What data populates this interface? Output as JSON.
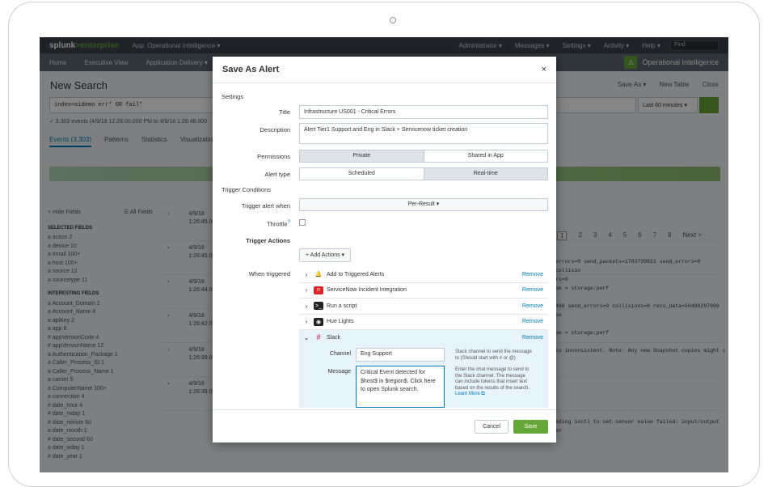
{
  "topbar": {
    "logo_a": "splunk",
    "logo_b": ">enterprise",
    "app": "App: Operational Intelligence ▾",
    "admin": "Administrator ▾",
    "messages": "Messages ▾",
    "settings": "Settings ▾",
    "activity": "Activity ▾",
    "help": "Help ▾",
    "find": "Find"
  },
  "appbar": {
    "items": [
      "Home",
      "Executive View",
      "Application Delivery ▾"
    ],
    "app_title": "Operational Intelligence"
  },
  "background": {
    "title": "New Search",
    "actions": [
      "Save As ▾",
      "New Table",
      "Close"
    ],
    "query": "index=oidemo err* OR fail*",
    "time_range": "Last 60 minutes ▾",
    "status": "✓ 3,303 events (4/9/18 12:26:00.000 PM to 4/9/18 1:26:48.000",
    "tabs": [
      "Events (3,303)",
      "Patterns",
      "Statistics",
      "Visualization"
    ],
    "pager": [
      "1",
      "2",
      "3",
      "4",
      "5",
      "6",
      "7",
      "8",
      "Next >"
    ],
    "sidebar": {
      "hide": "< Hide Fields",
      "all": "☰ All Fields",
      "selected_header": "SELECTED FIELDS",
      "selected": [
        "a action 2",
        "a device 10",
        "a email 100+",
        "a host 100+",
        "a source 12",
        "a sourcetype 11"
      ],
      "interesting_header": "INTERESTING FIELDS",
      "interesting": [
        "a Account_Domain 2",
        "a Account_Name 4",
        "a apiKey 2",
        "a app 6",
        "# appVersionCode 4",
        "# appVersionName 12",
        "a Authentication_Package 1",
        "a Caller_Process_ID 1",
        "a Caller_Process_Name 1",
        "a carrier 5",
        "a ComputerName 100+",
        "a connection 4",
        "# date_hour 4",
        "# date_mday 1",
        "# date_minute 60",
        "a date_month 1",
        "# date_second 60",
        "a date_wday 1",
        "# date_year 1"
      ]
    },
    "rows": [
      {
        "date": "4/9/18",
        "time": "1:26:45.000"
      },
      {
        "date": "4/9/18",
        "time": "1:26:45.000"
      },
      {
        "date": "4/9/18",
        "time": "1:26:44.000"
      },
      {
        "date": "4/9/18",
        "time": "1:26:42.000"
      },
      {
        "date": "4/9/18",
        "time": "1:26:39.000"
      },
      {
        "date": "4/9/18",
        "time": "1:26:39.000"
      }
    ],
    "code_lines": [
      "errors=0 send_packets=1783739821 send_errors=0 collisio",
      "rs=0",
      "pe = storage:perf",
      "",
      "468 send_errors=0 collisions=0 recv_data=50496297609 se",
      "",
      "pe = storage:perf",
      "",
      "is inconsistent. Note: Any new Snapshot copies might c",
      "",
      "",
      "",
      "",
      "",
      "",
      "",
      "ading ioctl to set sensor value failed: input/output er"
    ]
  },
  "modal": {
    "title": "Save As Alert",
    "close": "×",
    "settings_label": "Settings",
    "title_label": "Title",
    "title_value": "Infrastructure US001 - Critical Errors",
    "desc_label": "Description",
    "desc_value": "Alert Tier1 Support and Eng in Slack + Servicenow ticket creation",
    "permissions_label": "Permissions",
    "perm_private": "Private",
    "perm_shared": "Shared in App",
    "alert_type_label": "Alert type",
    "type_scheduled": "Scheduled",
    "type_realtime": "Real-time",
    "trigger_conditions": "Trigger Conditions",
    "trigger_when_label": "Trigger alert when",
    "trigger_when_value": "Per-Result ▾",
    "throttle_label": "Throttle",
    "trigger_actions": "Trigger Actions",
    "add_actions": "+ Add Actions ▾",
    "when_triggered": "When triggered",
    "remove": "Remove",
    "actions": [
      {
        "name": "Add to Triggered Alerts"
      },
      {
        "name": "ServiceNow Incident Integration"
      },
      {
        "name": "Run a script"
      },
      {
        "name": "Hue Lights"
      },
      {
        "name": "Slack"
      }
    ],
    "slack": {
      "channel_label": "Channel",
      "channel_value": "Eng Support",
      "channel_help": "Slack channel to send the message to (Should start with # or @)",
      "message_label": "Message",
      "message_value": "Critical Event detected for $host$ in $region$. Click here to open Splunk search.",
      "message_help": "Enter the chat message to send to the Slack channel. The message can include tokens that insert text based on the results of the search.",
      "learn_more": "Learn More ⧉"
    },
    "cancel": "Cancel",
    "save": "Save"
  },
  "colors": {
    "accent": "#65a637",
    "link": "#007abd",
    "topbar": "#3c444d"
  }
}
